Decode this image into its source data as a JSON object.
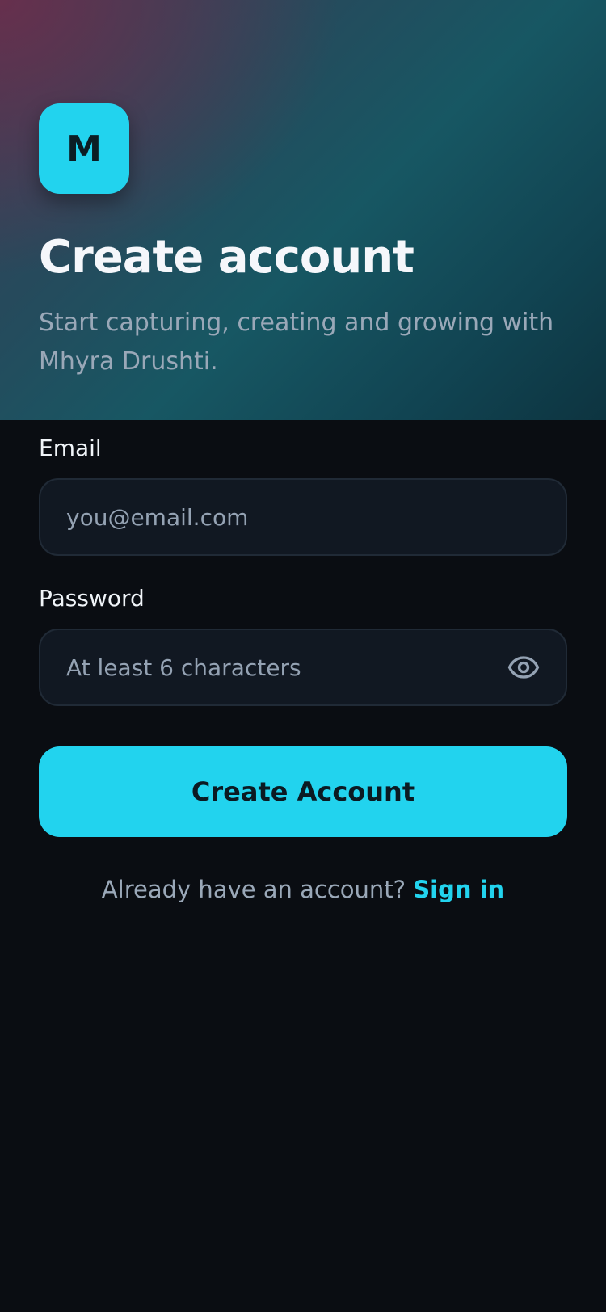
{
  "brand": {
    "logo_letter": "M",
    "accent_color": "#22d3ee"
  },
  "header": {
    "title": "Create account",
    "subtitle": "Start capturing, creating and growing with Mhyra Drushti."
  },
  "form": {
    "email": {
      "label": "Email",
      "placeholder": "you@email.com",
      "value": ""
    },
    "password": {
      "label": "Password",
      "placeholder": "At least 6 characters",
      "value": "",
      "toggle_icon": "eye-icon"
    },
    "submit_label": "Create Account"
  },
  "footer": {
    "prompt": "Already have an account?",
    "link_label": "Sign in"
  }
}
